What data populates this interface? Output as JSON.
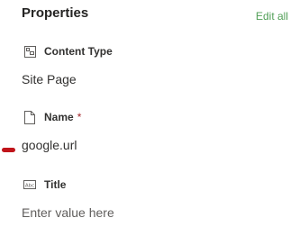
{
  "panel": {
    "title": "Properties",
    "edit_all_label": "Edit all"
  },
  "properties": [
    {
      "label": "Content Type",
      "value": "Site Page",
      "icon": "content-type-icon"
    },
    {
      "label": "Name",
      "required_mark": "*",
      "value": "google.url",
      "icon": "document-icon"
    },
    {
      "label": "Title",
      "placeholder": "Enter value here",
      "icon": "text-field-icon"
    }
  ],
  "annotation": {
    "color": "#c0141a"
  }
}
